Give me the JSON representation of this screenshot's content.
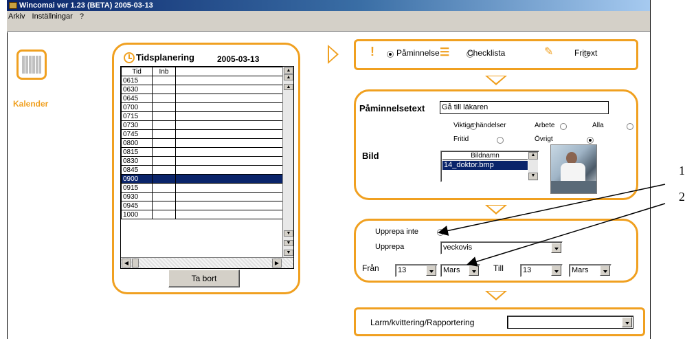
{
  "window": {
    "title": "Wincomai ver 1.23 (BETA) 2005-03-13"
  },
  "menu": {
    "items": [
      "Arkiv",
      "Inställningar",
      "?"
    ]
  },
  "sidebar": {
    "kalender_label": "Kalender"
  },
  "schedule": {
    "title": "Tidsplanering",
    "date": "2005-03-13",
    "col_tid": "Tid",
    "col_inb": "Inb",
    "times": [
      "0615",
      "0630",
      "0645",
      "0700",
      "0715",
      "0730",
      "0745",
      "0800",
      "0815",
      "0830",
      "0845",
      "0900",
      "0915",
      "0930",
      "0945",
      "1000"
    ],
    "selected_time": "0900",
    "delete_button": "Ta bort"
  },
  "type_panel": {
    "reminder_label": "Påminnelse",
    "checklist_label": "Checklista",
    "freetext_label": "Fritext",
    "selected": "Påminnelse"
  },
  "reminder_panel": {
    "text_label": "Påminnelsetext",
    "text_value": "Gå till läkaren",
    "categories": [
      "Viktiga händelser",
      "Arbete",
      "Alla",
      "Fritid",
      "Övrigt"
    ],
    "selected_category": "Övrigt",
    "image_label": "Bild",
    "image_list_header": "Bildnamn",
    "image_list_items": [
      "14_doktor.bmp"
    ]
  },
  "repeat_panel": {
    "no_repeat_label": "Upprepa inte",
    "repeat_label": "Upprepa",
    "repeat_value": "veckovis",
    "from_label": "Från",
    "from_day": "13",
    "from_month": "Mars",
    "to_label": "Till",
    "to_day": "13",
    "to_month": "Mars"
  },
  "alarm_panel": {
    "label": "Larm/kvittering/Rapportering",
    "value": ""
  },
  "callouts": {
    "one": "1",
    "two": "2"
  },
  "colors": {
    "accent": "#f0a020",
    "selection": "#0a246a",
    "title_bar": "#0a246a"
  }
}
